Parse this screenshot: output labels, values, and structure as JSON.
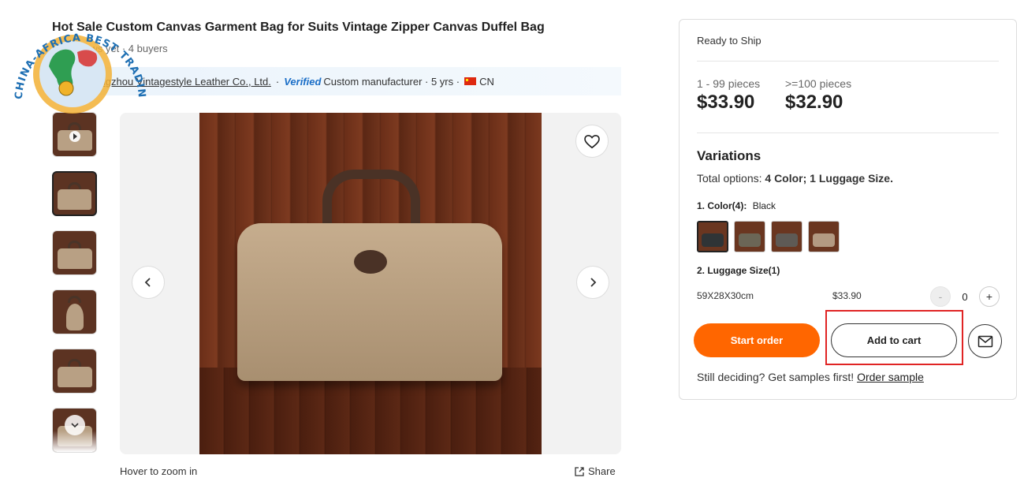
{
  "watermark": {
    "text": "CHINA-AFRICA BEST TRADING PLATFORM"
  },
  "product": {
    "title": "Hot Sale Custom Canvas Garment Bag for Suits Vintage Zipper Canvas Duffel Bag",
    "meta": "No reviews yet · 4 buyers",
    "supplier": {
      "company": "Guangzhou Vintagestyle Leather Co., Ltd.",
      "separator": "·",
      "verified": "Verified",
      "type": "Custom manufacturer · 5 yrs ·",
      "country": "CN"
    }
  },
  "gallery": {
    "hover_hint": "Hover to zoom in",
    "share_label": "Share"
  },
  "purchase": {
    "ready_label": "Ready to Ship",
    "tiers": [
      {
        "qty": "1 - 99 pieces",
        "price": "$33.90"
      },
      {
        "qty": ">=100 pieces",
        "price": "$32.90"
      }
    ],
    "variations_title": "Variations",
    "total_options_prefix": "Total options:",
    "total_options_value": "4 Color; 1 Luggage Size.",
    "color_label": "1. Color(4):",
    "color_selected": "Black",
    "swatch_colors": [
      "#2f3436",
      "#6b6656",
      "#5e5a55",
      "#b39a82"
    ],
    "size_label": "2. Luggage Size(1)",
    "size_name": "59X28X30cm",
    "size_price": "$33.90",
    "quantity": "0",
    "minus_label": "-",
    "plus_label": "+",
    "start_order": "Start order",
    "add_to_cart": "Add to cart",
    "deciding_text": "Still deciding? Get samples first!",
    "order_sample": "Order sample"
  },
  "colors": {
    "accent": "#ff6600",
    "highlight": "#e02424"
  }
}
